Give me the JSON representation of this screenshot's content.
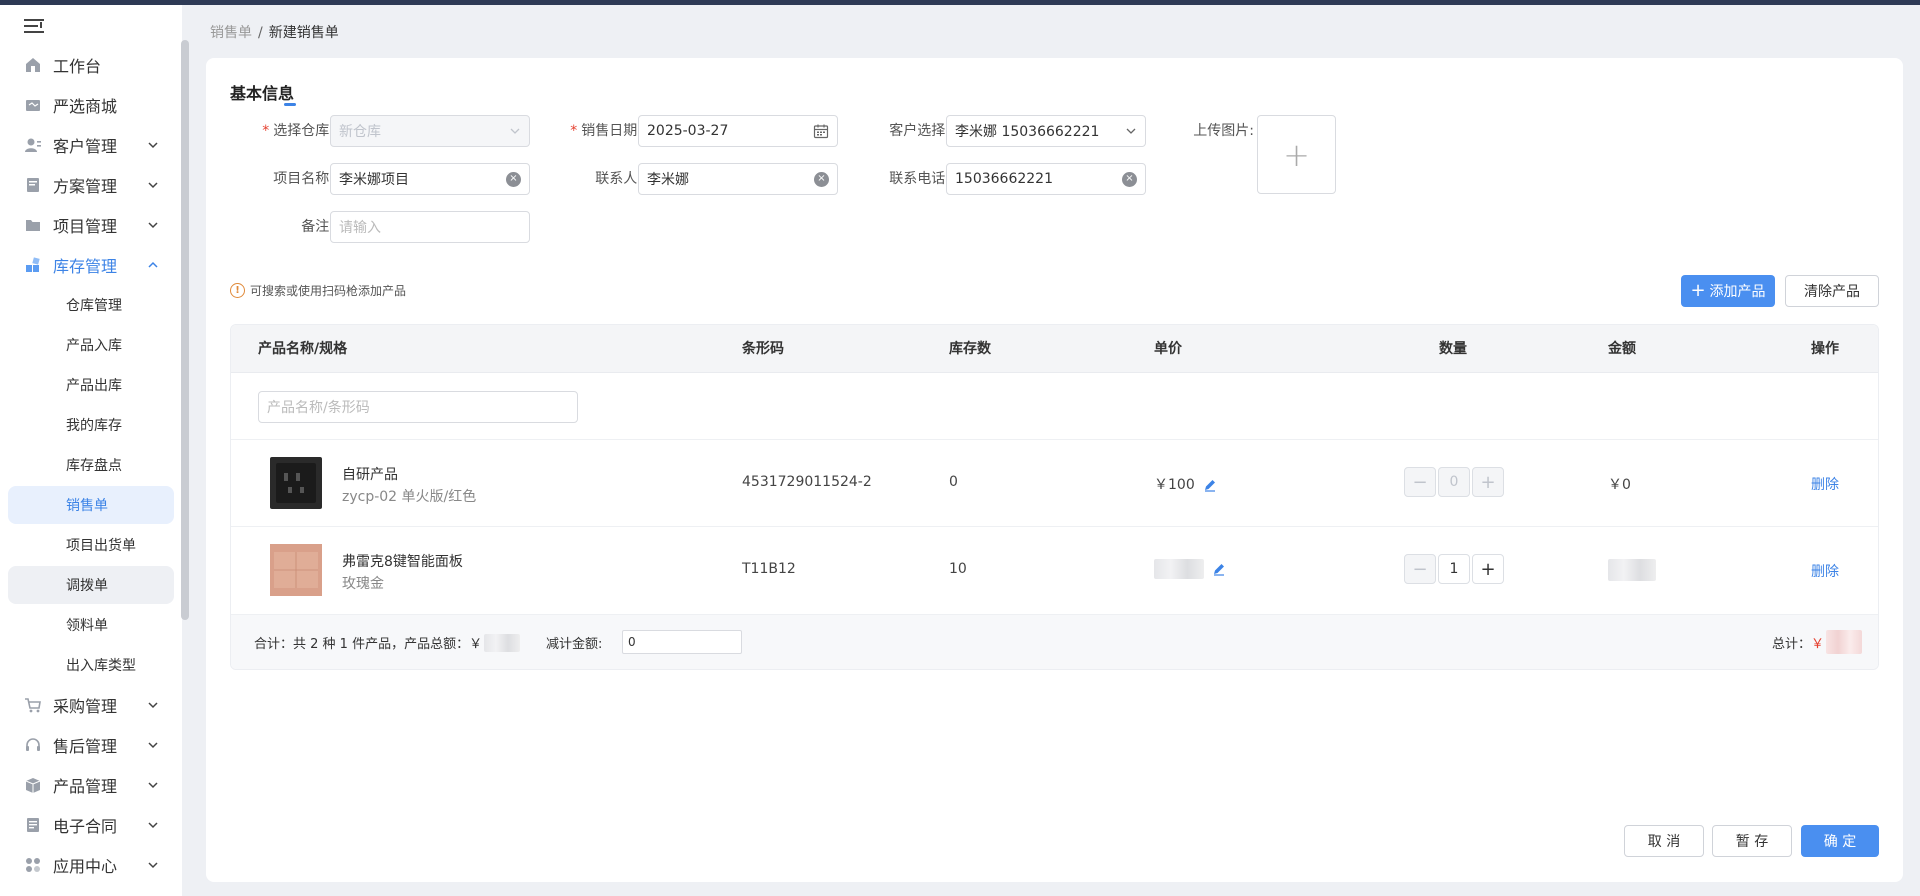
{
  "breadcrumb": {
    "parent": "销售单",
    "separator": "/",
    "current": "新建销售单"
  },
  "sidebar": {
    "items": [
      {
        "label": "工作台",
        "icon": "home-icon"
      },
      {
        "label": "严选商城",
        "icon": "mall-icon"
      },
      {
        "label": "客户管理",
        "icon": "customer-icon"
      },
      {
        "label": "方案管理",
        "icon": "plan-icon"
      },
      {
        "label": "项目管理",
        "icon": "folder-icon"
      },
      {
        "label": "库存管理",
        "icon": "inventory-icon"
      },
      {
        "label": "采购管理",
        "icon": "cart-icon"
      },
      {
        "label": "售后管理",
        "icon": "headset-icon"
      },
      {
        "label": "产品管理",
        "icon": "box-icon"
      },
      {
        "label": "电子合同",
        "icon": "contract-icon"
      },
      {
        "label": "应用中心",
        "icon": "apps-icon"
      }
    ],
    "sub_items": [
      "仓库管理",
      "产品入库",
      "产品出库",
      "我的库存",
      "库存盘点",
      "销售单",
      "项目出货单",
      "调拨单",
      "领料单",
      "出入库类型"
    ]
  },
  "form": {
    "section_title": "基本信息",
    "warehouse_label": "选择仓库:",
    "warehouse_value": "新仓库",
    "date_label": "销售日期:",
    "date_value": "2025-03-27",
    "customer_label": "客户选择:",
    "customer_value": "李米娜 15036662221",
    "upload_label": "上传图片:",
    "project_label": "项目名称:",
    "project_value": "李米娜项目",
    "contact_label": "联系人:",
    "contact_value": "李米娜",
    "phone_label": "联系电话:",
    "phone_value": "15036662221",
    "remark_label": "备注:",
    "remark_placeholder": "请输入"
  },
  "hint": "可搜索或使用扫码枪添加产品",
  "toolbar": {
    "add_label": "添加产品",
    "clear_label": "清除产品"
  },
  "table": {
    "headers": [
      "产品名称/规格",
      "条形码",
      "库存数",
      "单价",
      "数量",
      "金额",
      "操作"
    ],
    "search_placeholder": "产品名称/条形码",
    "rows": [
      {
        "name": "自研产品",
        "spec": "zycp-02 单火版/红色",
        "barcode": "4531729011524-2",
        "stock": "0",
        "price": "￥100",
        "qty": "0",
        "amount": "￥0",
        "action": "删除"
      },
      {
        "name": "弗雷克8键智能面板",
        "spec": "玫瑰金",
        "barcode": "T11B12",
        "stock": "10",
        "price": "",
        "qty": "1",
        "amount": "",
        "action": "删除"
      }
    ],
    "footer": {
      "summary": "合计：共 2 种 1 件产品，产品总额：￥",
      "discount_label": "减计金额:",
      "discount_value": "0",
      "total_label": "总计：",
      "total_currency": "￥"
    }
  },
  "actions": {
    "cancel": "取 消",
    "draft": "暂 存",
    "confirm": "确 定"
  },
  "colors": {
    "accent": "#4a8ff0",
    "required": "#e5402f",
    "warning": "#e08a3a"
  }
}
